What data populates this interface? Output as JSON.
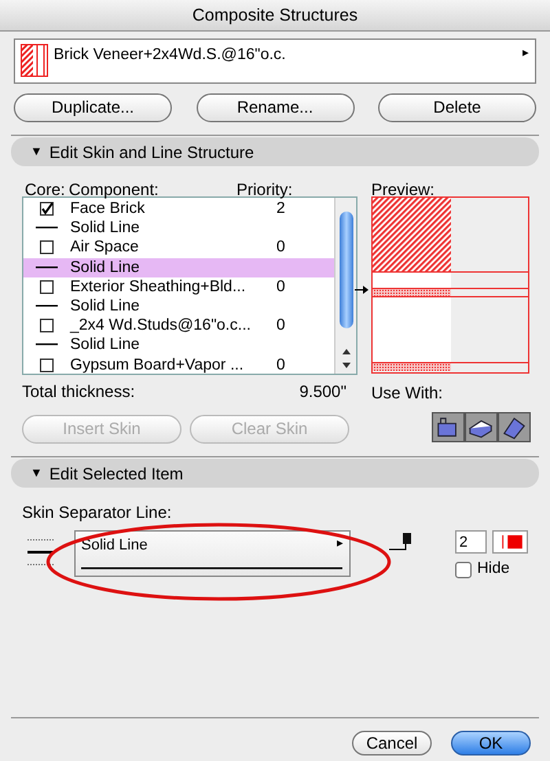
{
  "window": {
    "title": "Composite Structures"
  },
  "structure": {
    "name": "Brick Veneer+2x4Wd.S.@16\"o.c.",
    "menu_arrow": "▸"
  },
  "top_buttons": [
    "Duplicate...",
    "Rename...",
    "Delete"
  ],
  "skin_section": {
    "toggle": "▼",
    "title": "Edit Skin and Line Structure",
    "expanded": true
  },
  "columns": {
    "core": "Core:",
    "component": "Component:",
    "priority": "Priority:",
    "preview": "Preview:"
  },
  "components": [
    {
      "kind": "skin",
      "checked": true,
      "name": "Face Brick",
      "priority": "2",
      "selected": false
    },
    {
      "kind": "line",
      "name": "Solid Line",
      "selected": false
    },
    {
      "kind": "skin",
      "checked": false,
      "name": "Air Space",
      "priority": "0",
      "selected": false
    },
    {
      "kind": "line",
      "name": "Solid Line",
      "selected": true
    },
    {
      "kind": "skin",
      "checked": false,
      "name": "Exterior Sheathing+Bld...",
      "priority": "0",
      "selected": false
    },
    {
      "kind": "line",
      "name": "Solid Line",
      "selected": false
    },
    {
      "kind": "skin",
      "checked": false,
      "name": "_2x4 Wd.Studs@16\"o.c...",
      "priority": "0",
      "selected": false
    },
    {
      "kind": "line",
      "name": "Solid Line",
      "selected": false
    },
    {
      "kind": "skin",
      "checked": false,
      "name": "Gypsum Board+Vapor ...",
      "priority": "0",
      "selected": false
    }
  ],
  "total": {
    "label": "Total thickness:",
    "value": "9.500\""
  },
  "use_with": {
    "label": "Use With:"
  },
  "skin_buttons": [
    {
      "label": "Insert Skin",
      "disabled": true
    },
    {
      "label": "Clear Skin",
      "disabled": true
    }
  ],
  "item_section": {
    "toggle": "▼",
    "title": "Edit Selected Item",
    "expanded": true
  },
  "separator": {
    "label": "Skin Separator Line:",
    "line_type": "Solid Line",
    "menu_arrow": "▸",
    "pen": "2",
    "hide_label": "Hide",
    "hidden": false
  },
  "footer_buttons": [
    {
      "label": "Cancel",
      "kind": "default"
    },
    {
      "label": "OK",
      "kind": "primary"
    }
  ]
}
